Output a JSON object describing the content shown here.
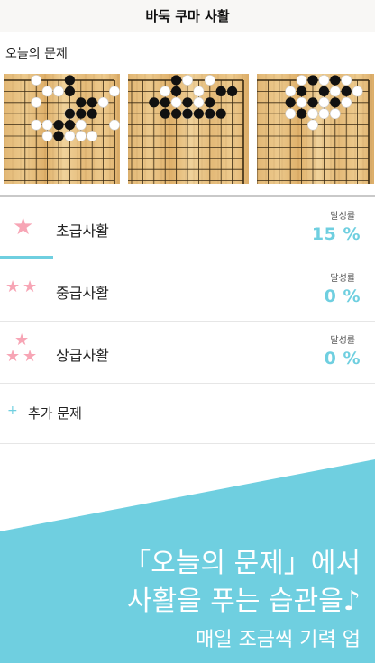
{
  "nav": {
    "title": "바둑 쿠마 사활"
  },
  "today": {
    "label": "오늘의 문제",
    "boards": [
      {
        "black": [
          [
            4,
            0
          ],
          [
            4,
            1
          ],
          [
            2,
            2
          ],
          [
            3,
            2
          ],
          [
            2,
            3
          ],
          [
            3,
            3
          ],
          [
            4,
            3
          ],
          [
            4,
            4
          ],
          [
            5,
            4
          ],
          [
            5,
            5
          ]
        ],
        "white": [
          [
            4,
            3
          ],
          [
            0,
            1
          ],
          [
            5,
            1
          ],
          [
            6,
            1
          ],
          [
            7,
            0
          ],
          [
            1,
            2
          ],
          [
            7,
            2
          ],
          [
            0,
            4
          ],
          [
            6,
            4
          ],
          [
            7,
            4
          ],
          [
            3,
            4
          ],
          [
            2,
            5
          ],
          [
            3,
            5
          ],
          [
            4,
            5
          ],
          [
            6,
            5
          ]
        ]
      },
      {
        "black": [
          [
            1,
            1
          ],
          [
            2,
            1
          ],
          [
            6,
            0
          ],
          [
            6,
            1
          ],
          [
            5,
            2
          ],
          [
            8,
            2
          ],
          [
            7,
            2
          ],
          [
            3,
            2
          ],
          [
            2,
            3
          ],
          [
            3,
            3
          ],
          [
            4,
            3
          ],
          [
            5,
            3
          ],
          [
            6,
            3
          ],
          [
            7,
            3
          ]
        ],
        "white": [
          [
            3,
            0
          ],
          [
            4,
            1
          ],
          [
            5,
            0
          ],
          [
            6,
            2
          ],
          [
            7,
            1
          ],
          [
            4,
            2
          ],
          [
            5,
            3
          ],
          [
            3,
            3
          ]
        ]
      },
      {
        "black": [
          [
            3,
            0
          ],
          [
            5,
            0
          ],
          [
            6,
            1
          ],
          [
            4,
            1
          ],
          [
            3,
            2
          ],
          [
            6,
            3
          ],
          [
            5,
            2
          ],
          [
            2,
            1
          ],
          [
            7,
            2
          ]
        ],
        "white": [
          [
            2,
            0
          ],
          [
            1,
            1
          ],
          [
            4,
            0
          ],
          [
            3,
            1
          ],
          [
            6,
            0
          ],
          [
            6,
            2
          ],
          [
            2,
            2
          ],
          [
            4,
            2
          ],
          [
            3,
            3
          ],
          [
            5,
            3
          ],
          [
            4,
            3
          ],
          [
            5,
            4
          ],
          [
            7,
            1
          ],
          [
            7,
            3
          ]
        ]
      }
    ]
  },
  "levels": [
    {
      "label": "초급사활",
      "rate_caption": "달성률",
      "rate": "15 %",
      "stars": 1,
      "progress": 0.15
    },
    {
      "label": "중급사활",
      "rate_caption": "달성률",
      "rate": "0 %",
      "stars": 2,
      "progress": 0
    },
    {
      "label": "상급사활",
      "rate_caption": "달성률",
      "rate": "0 %",
      "stars": 3,
      "progress": 0
    }
  ],
  "extra": {
    "label": "추가 문제",
    "icon": "plus-icon"
  },
  "promo": {
    "line1": "「오늘의 문제」에서",
    "line2": "사활을 푸는 습관을♪",
    "line3": "매일 조금씩 기력 업"
  },
  "colors": {
    "accent": "#6fcfe0",
    "star": "#f7a5b5",
    "board": "#e8c080"
  }
}
